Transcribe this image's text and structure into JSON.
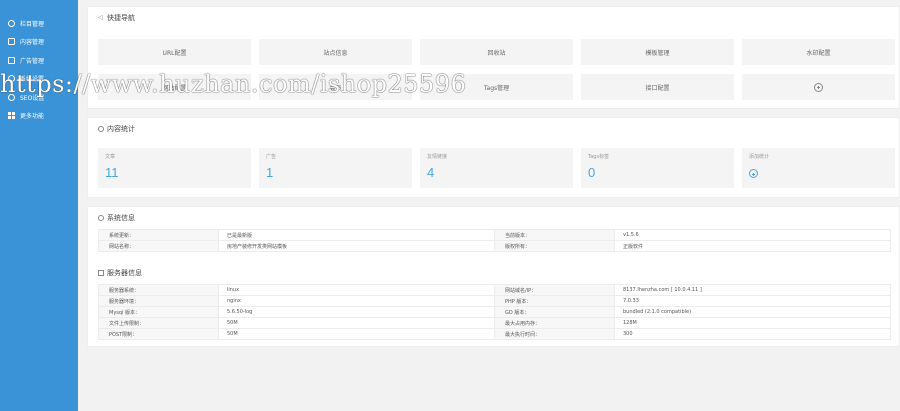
{
  "sidebar": {
    "items": [
      {
        "label": "栏目管理",
        "icon": "settings-icon"
      },
      {
        "label": "内容管理",
        "icon": "document-icon"
      },
      {
        "label": "广告管理",
        "icon": "ad-icon"
      },
      {
        "label": "系统设置",
        "icon": "system-icon"
      },
      {
        "label": "SEO设置",
        "icon": "seo-icon"
      },
      {
        "label": "更多功能",
        "icon": "grid-icon"
      }
    ],
    "bg_color": "#3a93d6"
  },
  "quick_nav": {
    "title": "快捷导航",
    "buttons": [
      "URL配置",
      "站点信息",
      "回收站",
      "模板管理",
      "水印配置",
      "网站配置",
      "会员",
      "Tags管理",
      "接口配置"
    ]
  },
  "stats": {
    "title": "内容统计",
    "cards": [
      {
        "label": "文章",
        "value": "11"
      },
      {
        "label": "广告",
        "value": "1"
      },
      {
        "label": "友情链接",
        "value": "4"
      },
      {
        "label": "Tags标签",
        "value": "0"
      },
      {
        "label": "添加统计"
      }
    ],
    "accent": "#4aa3df"
  },
  "system_info": {
    "title": "系统信息",
    "rows": [
      {
        "l1": "系统更新：",
        "v1": "已是最新版",
        "l2": "当前版本：",
        "v2": "v1.5.6"
      },
      {
        "l1": "网站名称：",
        "v1": "房地产装修开发类网站模板",
        "l2": "版权所有：",
        "v2": "正版软件"
      }
    ]
  },
  "server_info": {
    "title": "服务器信息",
    "rows": [
      {
        "l1": "服务器系统：",
        "v1": "linux",
        "l2": "网站域名/IP：",
        "v2": "8137.lhenzha.com [ 10.0.4.11 ]"
      },
      {
        "l1": "服务器环境：",
        "v1": "nginx",
        "l2": "PHP 版本：",
        "v2": "7.0.33"
      },
      {
        "l1": "Mysql 版本：",
        "v1": "5.6.50-log",
        "l2": "GD 版本：",
        "v2": "bundled (2.1.0 compatible)"
      },
      {
        "l1": "文件上传限制：",
        "v1": "50M",
        "l2": "最大占用内存：",
        "v2": "128M"
      },
      {
        "l1": "POST限制：",
        "v1": "50M",
        "l2": "最大执行时间：",
        "v2": "300"
      }
    ]
  },
  "watermark": "https://www.huzhan.com/ishop25596"
}
